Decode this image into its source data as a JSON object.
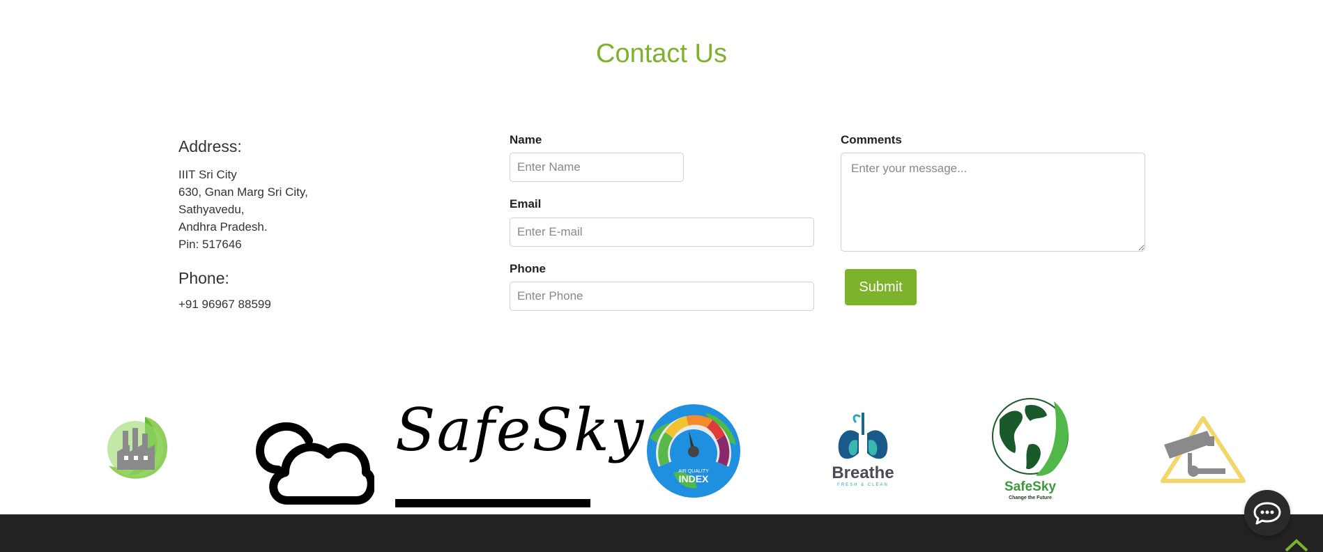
{
  "page": {
    "title": "Contact Us"
  },
  "address": {
    "heading": "Address:",
    "lines": [
      "IIIT Sri City",
      "630, Gnan Marg Sri City,",
      "Sathyavedu,",
      "Andhra Pradesh.",
      "Pin: 517646"
    ]
  },
  "phone": {
    "heading": "Phone:",
    "value": "+91 96967 88599"
  },
  "form": {
    "name_label": "Name",
    "name_placeholder": "Enter Name",
    "email_label": "Email",
    "email_placeholder": "Enter E-mail",
    "phone_label": "Phone",
    "phone_placeholder": "Enter Phone",
    "comments_label": "Comments",
    "comments_placeholder": "Enter your message...",
    "submit_label": "Submit"
  },
  "logos": {
    "safesky_wordmark": "SafeSky",
    "aqi_small": "AIR QUALITY",
    "aqi_big": "INDEX",
    "breathe_title": "Breathe",
    "breathe_sub": "FRESH & CLEAN",
    "globe_title": "SafeSky",
    "globe_sub": "Change the Future"
  },
  "colors": {
    "accent": "#7cb32b",
    "footer": "#222222"
  },
  "icons": [
    "factory-leaf-icon",
    "cloud-icon",
    "aqi-gauge-icon",
    "lungs-icon",
    "globe-leaf-icon",
    "cctv-warning-icon",
    "chat-icon",
    "chevron-up-icon"
  ]
}
